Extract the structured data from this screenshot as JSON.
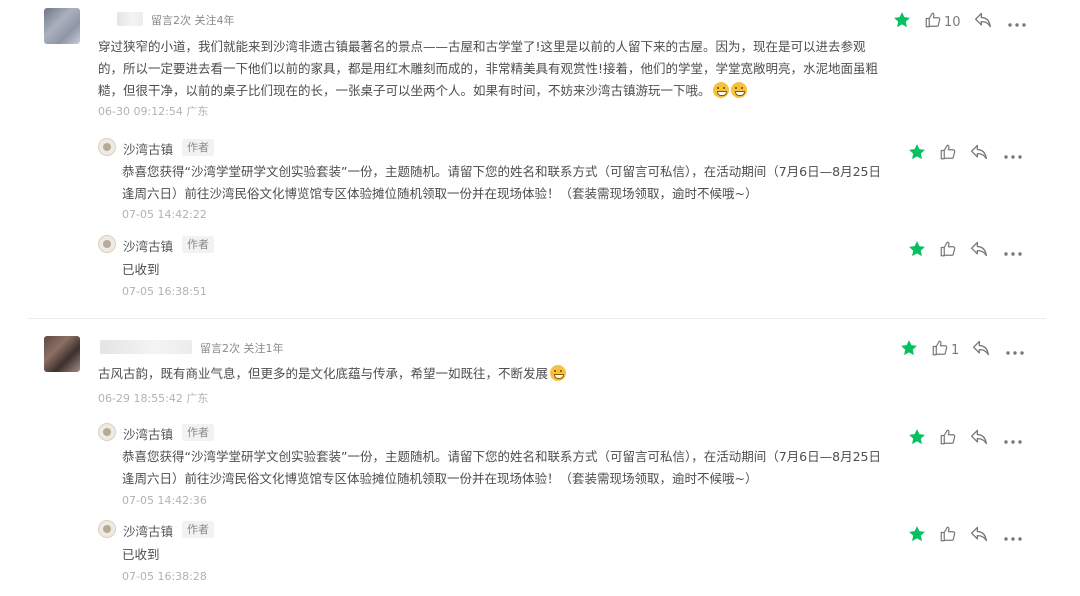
{
  "comments": [
    {
      "meta": "留言2次  关注4年",
      "text": "穿过狭窄的小道，我们就能来到沙湾非遗古镇最著名的景点——古屋和古学堂了!这里是以前的人留下来的古屋。因为，现在是可以进去参观的，所以一定要进去看一下他们以前的家具，都是用红木雕刻而成的，非常精美具有观赏性!接着，他们的学堂，学堂宽敞明亮，水泥地面虽粗糙，但很干净，以前的桌子比们现在的长，一张桌子可以坐两个人。如果有时间，不妨来沙湾古镇游玩一下哦。",
      "time": "06-30 09:12:54 广东",
      "like_count": "10",
      "replies": [
        {
          "name": "沙湾古镇",
          "tag": "作者",
          "text": "恭喜您获得“沙湾学堂研学文创实验套装”一份，主题随机。请留下您的姓名和联系方式（可留言可私信），在活动期间（7月6日—8月25日逢周六日）前往沙湾民俗文化博览馆专区体验摊位随机领取一份并在现场体验！（套装需现场领取，逾时不候哦~）",
          "time": "07-05 14:42:22"
        },
        {
          "name": "沙湾古镇",
          "tag": "作者",
          "text": "已收到",
          "time": "07-05 16:38:51"
        }
      ]
    },
    {
      "meta": "留言2次  关注1年",
      "text": "古风古韵，既有商业气息，但更多的是文化底蕴与传承，希望一如既往，不断发展",
      "time": "06-29 18:55:42 广东",
      "like_count": "1",
      "replies": [
        {
          "name": "沙湾古镇",
          "tag": "作者",
          "text": "恭喜您获得“沙湾学堂研学文创实验套装”一份，主题随机。请留下您的姓名和联系方式（可留言可私信），在活动期间（7月6日—8月25日逢周六日）前往沙湾民俗文化博览馆专区体验摊位随机领取一份并在现场体验！（套装需现场领取，逾时不候哦~）",
          "time": "07-05 14:42:36"
        },
        {
          "name": "沙湾古镇",
          "tag": "作者",
          "text": "已收到",
          "time": "07-05 16:38:28"
        }
      ]
    }
  ],
  "icons": {
    "star": "star-icon",
    "like": "thumbs-up-icon",
    "reply": "reply-arrow-icon",
    "more": "more-dots-icon"
  },
  "colors": {
    "star_green": "#07c160",
    "icon_gray": "#7a7a7a"
  }
}
